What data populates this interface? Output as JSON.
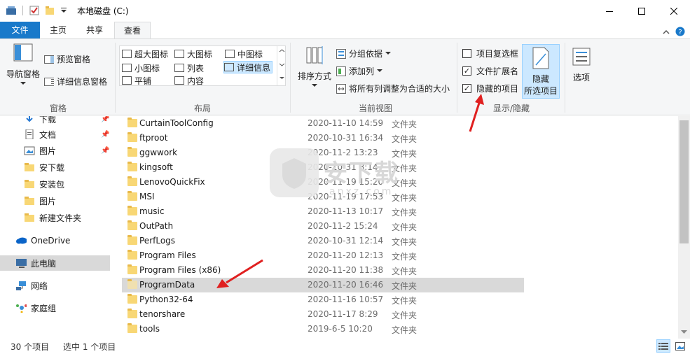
{
  "window": {
    "title": "本地磁盘 (C:)",
    "controls": {
      "minimize": "─",
      "maximize": "☐",
      "close": "✕"
    }
  },
  "tabs": [
    {
      "label": "文件"
    },
    {
      "label": "主页"
    },
    {
      "label": "共享"
    },
    {
      "label": "查看"
    }
  ],
  "ribbon": {
    "pane_group": {
      "label": "窗格",
      "nav_pane": "导航窗格",
      "preview_pane": "预览窗格",
      "details_pane": "详细信息窗格"
    },
    "layout_group": {
      "label": "布局",
      "items": [
        "超大图标",
        "大图标",
        "中图标",
        "小图标",
        "列表",
        "详细信息",
        "平铺",
        "内容"
      ]
    },
    "view_group": {
      "label": "当前视图",
      "sort_by": "排序方式",
      "group_by": "分组依据",
      "add_column": "添加列",
      "fit_columns": "将所有列调整为合适的大小"
    },
    "show_hide_group": {
      "label": "显示/隐藏",
      "item_checkboxes": "项目复选框",
      "file_extensions": "文件扩展名",
      "hidden_items": "隐藏的项目",
      "checked": {
        "item_checkboxes": false,
        "file_extensions": true,
        "hidden_items": true
      },
      "hide_selected_line1": "隐藏",
      "hide_selected_line2": "所选项目",
      "options": "选项"
    }
  },
  "nav": {
    "items": [
      {
        "label": "下载"
      },
      {
        "label": "文档"
      },
      {
        "label": "图片"
      },
      {
        "label": "安下载"
      },
      {
        "label": "安装包"
      },
      {
        "label": "图片"
      },
      {
        "label": "新建文件夹"
      },
      {
        "label": "OneDrive"
      },
      {
        "label": "此电脑"
      },
      {
        "label": "网络"
      },
      {
        "label": "家庭组"
      }
    ]
  },
  "files": [
    {
      "name": "CurtainToolConfig",
      "date": "2020-11-10 14:59",
      "type": "文件夹"
    },
    {
      "name": "ftproot",
      "date": "2020-10-31 16:34",
      "type": "文件夹"
    },
    {
      "name": "ggwwork",
      "date": "2020-11-2 13:23",
      "type": "文件夹"
    },
    {
      "name": "kingsoft",
      "date": "2020-10-31 8:14",
      "type": "文件夹"
    },
    {
      "name": "LenovoQuickFix",
      "date": "2020-11-19 15:20",
      "type": "文件夹"
    },
    {
      "name": "MSI",
      "date": "2020-11-19 17:53",
      "type": "文件夹"
    },
    {
      "name": "music",
      "date": "2020-11-13 10:17",
      "type": "文件夹"
    },
    {
      "name": "OutPath",
      "date": "2020-11-2 15:24",
      "type": "文件夹"
    },
    {
      "name": "PerfLogs",
      "date": "2020-10-31 12:14",
      "type": "文件夹"
    },
    {
      "name": "Program Files",
      "date": "2020-11-20 12:13",
      "type": "文件夹"
    },
    {
      "name": "Program Files (x86)",
      "date": "2020-11-20 11:38",
      "type": "文件夹"
    },
    {
      "name": "ProgramData",
      "date": "2020-11-20 16:46",
      "type": "文件夹"
    },
    {
      "name": "Python32-64",
      "date": "2020-11-16 10:57",
      "type": "文件夹"
    },
    {
      "name": "tenorshare",
      "date": "2020-11-17 8:29",
      "type": "文件夹"
    },
    {
      "name": "tools",
      "date": "2019-6-5 10:20",
      "type": "文件夹"
    }
  ],
  "status": {
    "item_count": "30 个项目",
    "selected": "选中 1 个项目"
  },
  "watermark": {
    "text": "安下载",
    "sub": "anxz.com"
  },
  "colors": {
    "file_tab": "#1979ca",
    "selection": "#d9d9d9",
    "arrow": "#e02020"
  }
}
